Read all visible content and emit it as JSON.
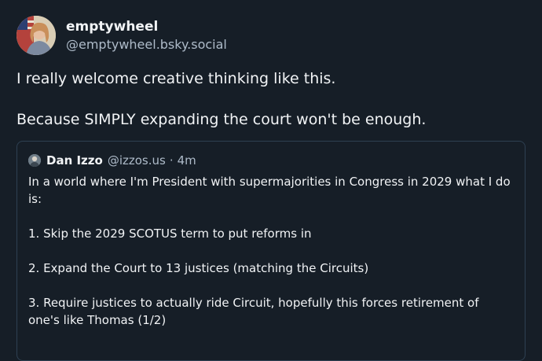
{
  "post": {
    "author": {
      "display_name": "emptywheel",
      "handle": "@emptywheel.bsky.social",
      "avatar_icon": "profile-photo"
    },
    "text_paragraphs": [
      "I really welcome creative thinking like this.",
      "Because SIMPLY expanding the court won't be enough."
    ]
  },
  "quote": {
    "author": {
      "display_name": "Dan Izzo",
      "handle": "@izzos.us",
      "separator": "·",
      "time": "4m",
      "avatar_icon": "profile-photo"
    },
    "paragraphs": [
      "In a world where I'm President with supermajorities in Congress in 2029 what I do is:",
      "1. Skip the 2029 SCOTUS term to put reforms in",
      "2. Expand the Court to 13 justices (matching the Circuits)",
      "3. Require justices to actually ride Circuit, hopefully this forces retirement of one's like Thomas (1/2)"
    ]
  },
  "colors": {
    "background": "#161e27",
    "text_primary": "#f1f3f5",
    "text_secondary": "#aebbc9",
    "card_border": "#2e4052"
  }
}
